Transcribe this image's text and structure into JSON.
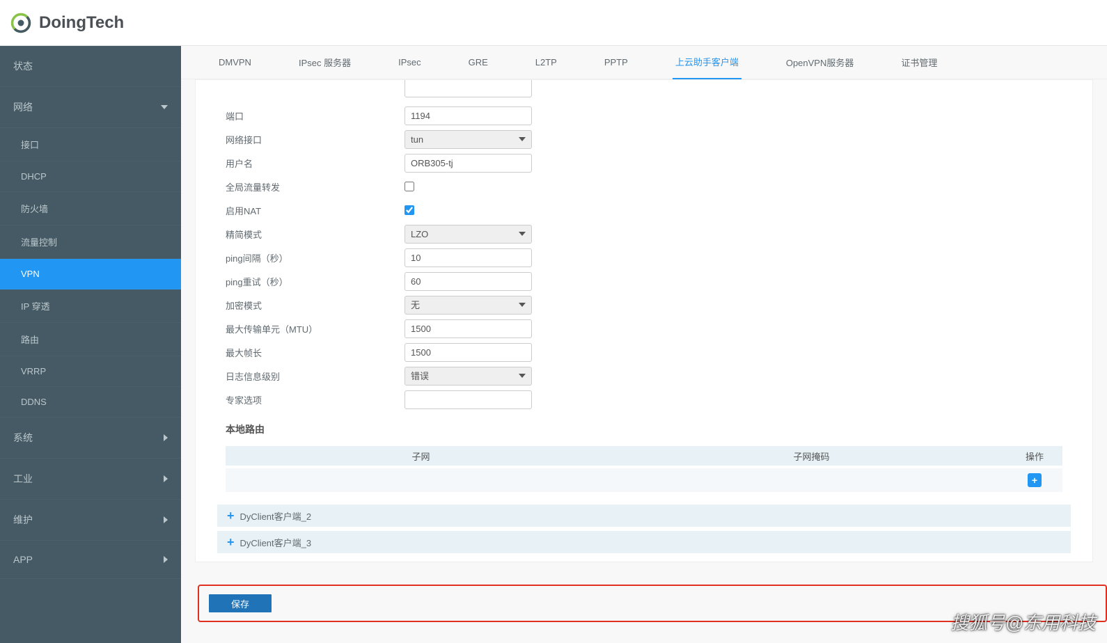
{
  "brand": "DoingTech",
  "sidebar": {
    "status": "状态",
    "network": "网络",
    "network_children": {
      "interface": "接口",
      "dhcp": "DHCP",
      "firewall": "防火墙",
      "traffic": "流量控制",
      "vpn": "VPN",
      "ip_passthrough": "IP 穿透",
      "route": "路由",
      "vrrp": "VRRP",
      "ddns": "DDNS"
    },
    "system": "系统",
    "industry": "工业",
    "maintenance": "维护",
    "app": "APP"
  },
  "tabs": {
    "dmvpn": "DMVPN",
    "ipsec_server": "IPsec 服务器",
    "ipsec": "IPsec",
    "gre": "GRE",
    "l2tp": "L2TP",
    "pptp": "PPTP",
    "cloud_client": "上云助手客户端",
    "openvpn_server": "OpenVPN服务器",
    "cert": "证书管理"
  },
  "form": {
    "port_label": "端口",
    "port_value": "1194",
    "net_if_label": "网络接口",
    "net_if_value": "tun",
    "username_label": "用户名",
    "username_value": "ORB305-tj",
    "global_fwd_label": "全局流量转发",
    "enable_nat_label": "启用NAT",
    "compress_label": "精简模式",
    "compress_value": "LZO",
    "ping_interval_label": "ping间隔（秒）",
    "ping_interval_value": "10",
    "ping_retry_label": "ping重试（秒）",
    "ping_retry_value": "60",
    "encrypt_label": "加密模式",
    "encrypt_value": "无",
    "mtu_label": "最大传输单元（MTU）",
    "mtu_value": "1500",
    "max_frame_label": "最大帧长",
    "max_frame_value": "1500",
    "log_level_label": "日志信息级别",
    "log_level_value": "错误",
    "expert_label": "专家选项",
    "expert_value": ""
  },
  "local_route": {
    "title": "本地路由",
    "col_subnet": "子网",
    "col_mask": "子网掩码",
    "col_op": "操作"
  },
  "clients": {
    "c2": "DyClient客户端_2",
    "c3": "DyClient客户端_3"
  },
  "save": "保存",
  "watermark": "搜狐号@东用科技"
}
